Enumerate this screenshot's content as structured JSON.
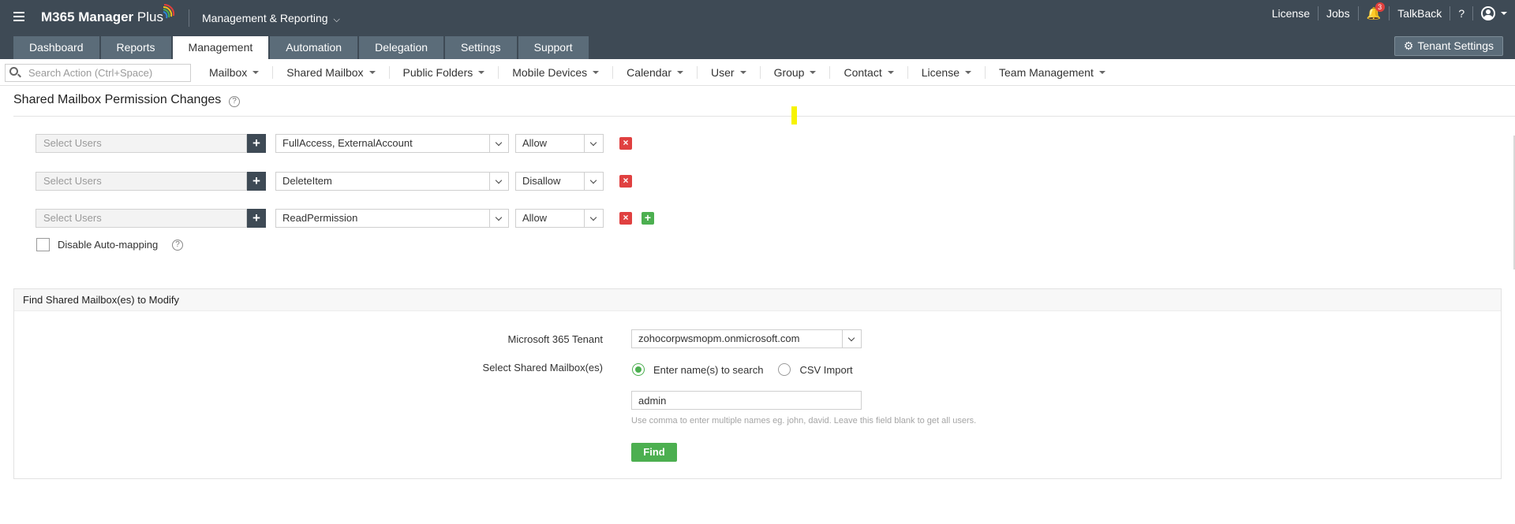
{
  "app": {
    "logo_main": "M365 Manager",
    "logo_plus": "Plus",
    "mode": "Management & Reporting"
  },
  "top_right": {
    "license": "License",
    "jobs": "Jobs",
    "notification_count": "3",
    "talkback": "TalkBack",
    "help": "?"
  },
  "tabs": [
    {
      "label": "Dashboard",
      "active": false
    },
    {
      "label": "Reports",
      "active": false
    },
    {
      "label": "Management",
      "active": true
    },
    {
      "label": "Automation",
      "active": false
    },
    {
      "label": "Delegation",
      "active": false
    },
    {
      "label": "Settings",
      "active": false
    },
    {
      "label": "Support",
      "active": false
    }
  ],
  "tenant_settings_label": "Tenant Settings",
  "search": {
    "placeholder": "Search Action (Ctrl+Space)"
  },
  "menu": [
    "Mailbox",
    "Shared Mailbox",
    "Public Folders",
    "Mobile Devices",
    "Calendar",
    "User",
    "Group",
    "Contact",
    "License",
    "Team Management"
  ],
  "page_title": "Shared Mailbox Permission Changes",
  "permission_rows": [
    {
      "users_placeholder": "Select Users",
      "permission": "FullAccess, ExternalAccount",
      "action": "Allow",
      "delete_label": "×"
    },
    {
      "users_placeholder": "Select Users",
      "permission": "DeleteItem",
      "action": "Disallow",
      "delete_label": "×"
    },
    {
      "users_placeholder": "Select Users",
      "permission": "ReadPermission",
      "action": "Allow",
      "delete_label": "×",
      "add_label": "+"
    }
  ],
  "plus_label": "+",
  "auto_mapping_label": "Disable Auto-mapping",
  "find_panel": {
    "header": "Find Shared Mailbox(es) to Modify",
    "tenant_label": "Microsoft 365 Tenant",
    "tenant_value": "zohocorpwsmopm.onmicrosoft.com",
    "select_label": "Select Shared Mailbox(es)",
    "radio_names": "Enter name(s) to search",
    "radio_csv": "CSV Import",
    "search_value": "admin",
    "hint": "Use comma to enter multiple names eg. john, david. Leave this field blank to get all users.",
    "find_button": "Find"
  },
  "colors": {
    "header_bg": "#3e4a55",
    "tab_bg": "#5b6c79",
    "accent_green": "#4caf50",
    "delete_red": "#e04040",
    "bell_yellow": "#f2c21b"
  }
}
